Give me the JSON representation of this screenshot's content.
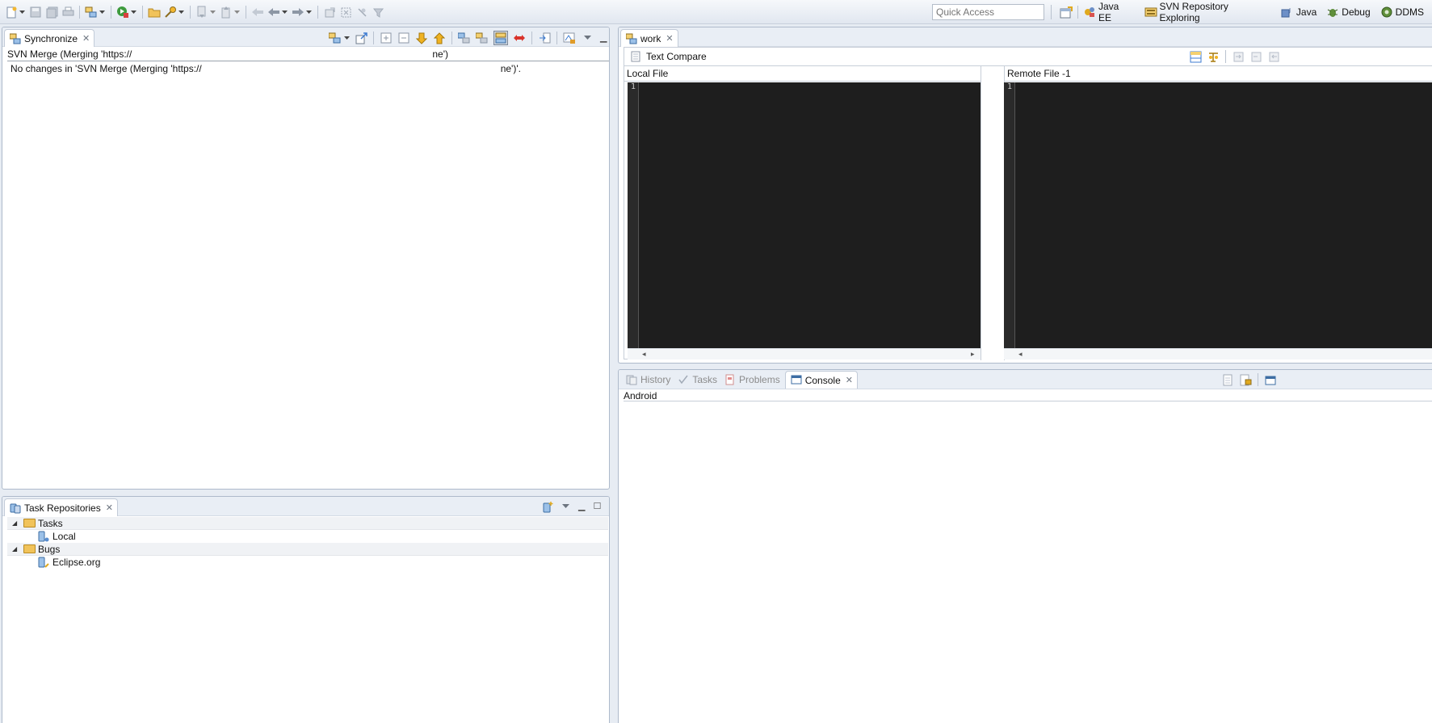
{
  "toolbar": {
    "quick_access_placeholder": "Quick Access",
    "perspectives": [
      {
        "label": "Java EE",
        "icon": "java-ee-perspective-icon"
      },
      {
        "label": "SVN Repository Exploring",
        "icon": "svn-perspective-icon"
      },
      {
        "label": "Java",
        "icon": "java-perspective-icon"
      },
      {
        "label": "Debug",
        "icon": "debug-perspective-icon"
      },
      {
        "label": "DDMS",
        "icon": "ddms-perspective-icon"
      }
    ]
  },
  "synchronize": {
    "tab_label": "Synchronize",
    "header_start": "SVN Merge (Merging 'https://",
    "header_end": "ne')",
    "message_start": "No changes in 'SVN Merge (Merging 'https://",
    "message_end": "ne')'."
  },
  "task_repositories": {
    "tab_label": "Task Repositories",
    "groups": [
      {
        "label": "Tasks",
        "children": [
          "Local"
        ]
      },
      {
        "label": "Bugs",
        "children": [
          "Eclipse.org"
        ]
      }
    ]
  },
  "editor": {
    "tab_label": "work",
    "compare_title": "Text Compare",
    "left_label": "Local File",
    "right_label": "Remote File -1",
    "left_line_number": "1",
    "right_line_number": "1"
  },
  "bottom_views": {
    "tabs": [
      "History",
      "Tasks",
      "Problems",
      "Console"
    ],
    "active_tab": "Console",
    "console_name": "Android"
  },
  "colors": {
    "editor_background": "#1e1e1e",
    "panel_border": "#aebacb",
    "toolbar_background": "#e1e7f0"
  }
}
